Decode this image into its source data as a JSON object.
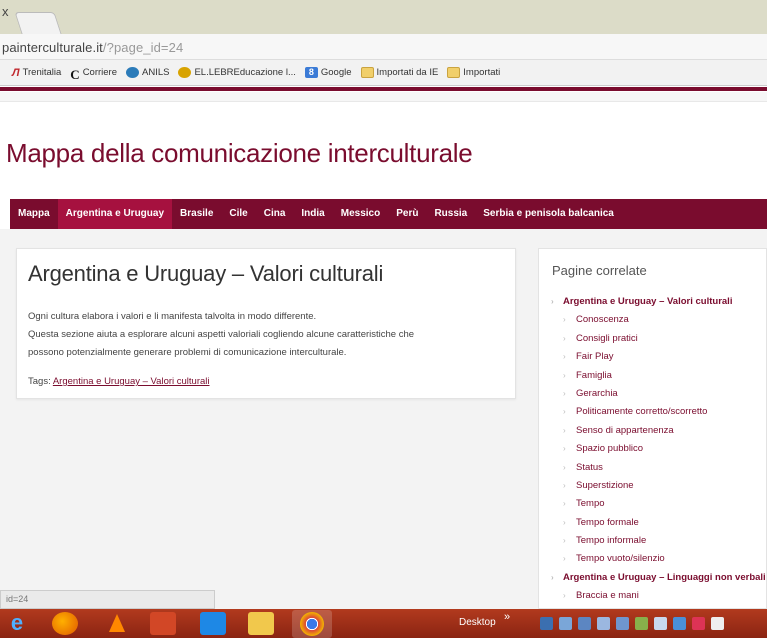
{
  "browser": {
    "tab_close": "x",
    "url_main": "painterculturale.it",
    "url_rest": "/?page_id=24",
    "status_text": "id=24"
  },
  "bookmarks": [
    {
      "label": "Trenitalia",
      "icon": "italo-icon"
    },
    {
      "label": "Corriere",
      "icon": "corriere-icon"
    },
    {
      "label": "ANILS",
      "icon": "anils-icon"
    },
    {
      "label": "EL.LEBREducazione l...",
      "icon": "ellebre-icon"
    },
    {
      "label": "Google",
      "icon": "google-icon"
    },
    {
      "label": "Importati da IE",
      "icon": "folder-icon"
    },
    {
      "label": "Importati",
      "icon": "folder-icon"
    }
  ],
  "site": {
    "title": "Mappa della comunicazione interculturale",
    "brand_color": "#7a0c2e"
  },
  "nav": [
    {
      "label": "Mappa",
      "active": false
    },
    {
      "label": "Argentina e Uruguay",
      "active": true
    },
    {
      "label": "Brasile",
      "active": false
    },
    {
      "label": "Cile",
      "active": false
    },
    {
      "label": "Cina",
      "active": false
    },
    {
      "label": "India",
      "active": false
    },
    {
      "label": "Messico",
      "active": false
    },
    {
      "label": "Perù",
      "active": false
    },
    {
      "label": "Russia",
      "active": false
    },
    {
      "label": "Serbia e penisola balcanica",
      "active": false
    }
  ],
  "article": {
    "title": "Argentina e Uruguay – Valori culturali",
    "paragraphs": [
      "Ogni cultura elabora i valori e li manifesta talvolta in modo differente.",
      "Questa sezione aiuta a esplorare alcuni aspetti valoriali cogliendo alcune caratteristiche che",
      "possono potenzialmente generare problemi di comunicazione interculturale."
    ],
    "tags_label": "Tags:",
    "tag_link": "Argentina e Uruguay – Valori culturali"
  },
  "sidebar": {
    "heading": "Pagine correlate",
    "items": [
      {
        "label": "Argentina e Uruguay – Valori culturali",
        "level": "top",
        "bold": true
      },
      {
        "label": "Conoscenza",
        "level": "sub"
      },
      {
        "label": "Consigli pratici",
        "level": "sub"
      },
      {
        "label": "Fair Play",
        "level": "sub"
      },
      {
        "label": "Famiglia",
        "level": "sub"
      },
      {
        "label": "Gerarchia",
        "level": "sub"
      },
      {
        "label": "Politicamente corretto/scorretto",
        "level": "sub"
      },
      {
        "label": "Senso di appartenenza",
        "level": "sub"
      },
      {
        "label": "Spazio pubblico",
        "level": "sub"
      },
      {
        "label": "Status",
        "level": "sub"
      },
      {
        "label": "Superstizione",
        "level": "sub"
      },
      {
        "label": "Tempo",
        "level": "sub"
      },
      {
        "label": "Tempo formale",
        "level": "sub"
      },
      {
        "label": "Tempo informale",
        "level": "sub"
      },
      {
        "label": "Tempo vuoto/silenzio",
        "level": "sub"
      },
      {
        "label": "Argentina e Uruguay – Linguaggi non verbali",
        "level": "top",
        "bold": false
      },
      {
        "label": "Braccia e mani",
        "level": "sub"
      }
    ]
  },
  "taskbar": {
    "desktop_label": "Desktop",
    "desktop_chevron": "»"
  }
}
